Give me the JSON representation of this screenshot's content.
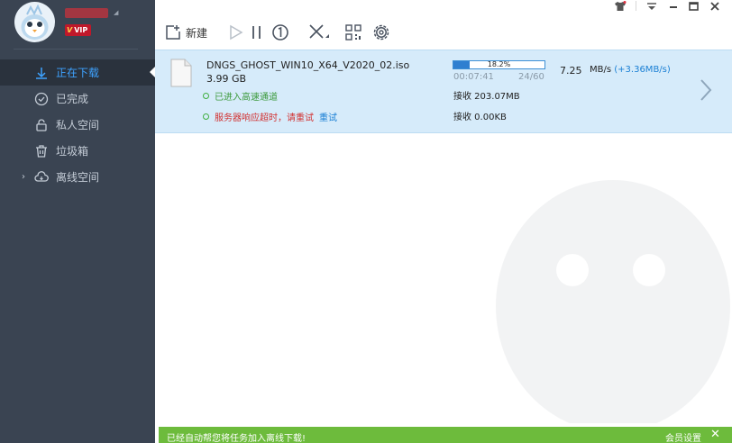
{
  "user": {
    "vip_label": "VIP"
  },
  "sidebar": {
    "items": [
      {
        "label": "正在下载",
        "icon": "download-icon"
      },
      {
        "label": "已完成",
        "icon": "check-circle-icon"
      },
      {
        "label": "私人空间",
        "icon": "lock-icon"
      },
      {
        "label": "垃圾箱",
        "icon": "trash-icon"
      },
      {
        "label": "离线空间",
        "icon": "cloud-icon"
      }
    ]
  },
  "toolbar": {
    "new_label": "新建"
  },
  "download": {
    "file_name": "DNGS_GHOST_WIN10_X64_V2020_02.iso",
    "file_size": "3.99 GB",
    "status_channel": "已进入高速通道",
    "status_error": "服务器响应超时，请重试",
    "retry_label": "重试",
    "progress_percent": 18.2,
    "progress_text": "18.2%",
    "elapsed": "00:07:41",
    "connections": "24/60",
    "speed_value": "7.25",
    "speed_unit": "MB/s",
    "speed_boost": "(+3.36MB/s)",
    "received_channel": "接收 203.07MB",
    "received_offline": "接收 0.00KB"
  },
  "bottom_bar": {
    "message": "已经自动帮您将任务加入离线下载!",
    "settings_label": "会员设置",
    "close_glyph": "✕"
  },
  "colors": {
    "sidebar_bg": "#3a4452",
    "active_blue": "#3ea2ff",
    "row_bg": "#d6ebfa",
    "progress_blue": "#2f7fd0",
    "bottom_green": "#6dbb3c",
    "error_red": "#d23030"
  }
}
